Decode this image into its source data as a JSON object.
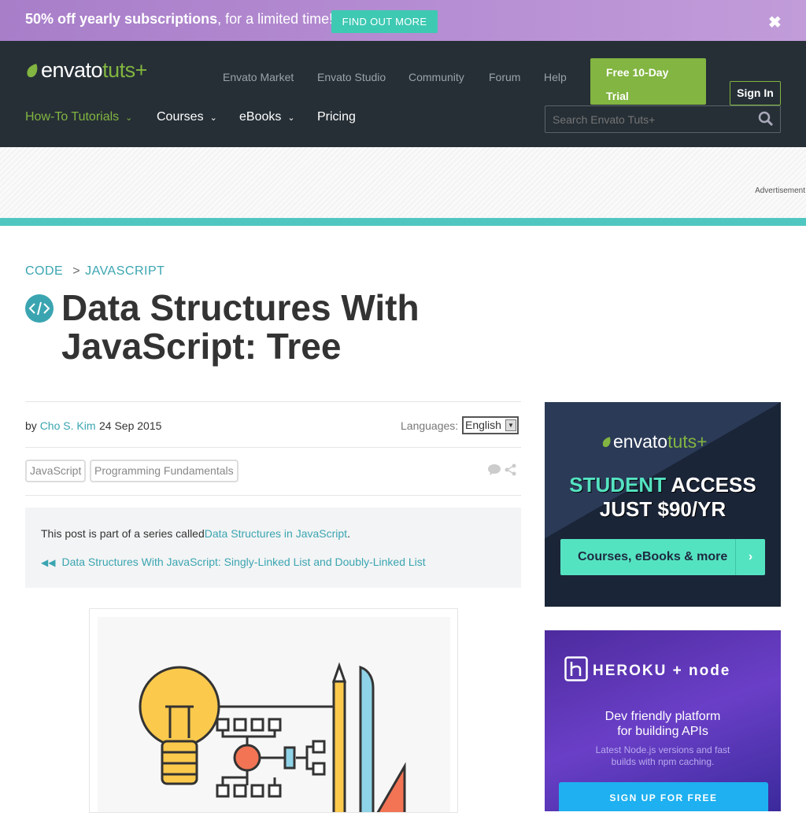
{
  "promo": {
    "bold_text": "50% off yearly subscriptions",
    "text": ", for a limited time!",
    "button": "FIND OUT MORE",
    "close": "✖"
  },
  "header": {
    "logo_main": "envato",
    "logo_tuts": "tuts+",
    "top_links": [
      "Envato Market",
      "Envato Studio",
      "Community",
      "Forum",
      "Help"
    ],
    "trial_line1": "Free 10-Day",
    "trial_line2": "Trial",
    "sign_in": "Sign In",
    "main_links": [
      "How-To Tutorials",
      "Courses",
      "eBooks",
      "Pricing"
    ],
    "search_placeholder": "Search Envato Tuts+"
  },
  "ad": {
    "label": "Advertisement"
  },
  "breadcrumb": {
    "section": "CODE",
    "separator": ">",
    "category": "JAVASCRIPT"
  },
  "article": {
    "title": "Data Structures With JavaScript: Tree",
    "by": "by",
    "author": "Cho S. Kim",
    "date": "24 Sep 2015",
    "languages_label": "Languages:",
    "language_selected": "English",
    "tags": [
      "JavaScript",
      "Programming Fundamentals"
    ],
    "series_prefix": "This post is part of a series called",
    "series_link": "Data Structures in JavaScript",
    "series_suffix": ".",
    "prev_link": "Data Structures With JavaScript: Singly-Linked List and Doubly-Linked List"
  },
  "sidebar": {
    "ad1": {
      "logo_main": "envato",
      "logo_tuts": "tuts+",
      "head_hl": "STUDENT",
      "head_rest": " ACCESS",
      "head_line2": "JUST $90/YR",
      "button": "Courses, eBooks & more",
      "arrow": "›"
    },
    "ad2": {
      "logo": "HEROKU + node",
      "title_line1": "Dev friendly platform",
      "title_line2": "for building APIs",
      "sub_line1": "Latest Node.js versions and fast",
      "sub_line2": "builds with npm caching.",
      "button": "SIGN UP FOR FREE"
    }
  },
  "colors": {
    "accent": "#82b541",
    "teal": "#3aa5b1",
    "nav_bg": "#262f36",
    "promo_bg": "#b78fd4"
  }
}
